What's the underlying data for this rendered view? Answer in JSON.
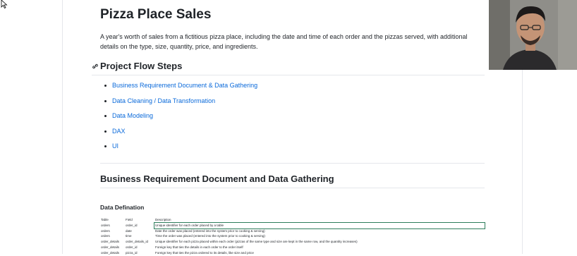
{
  "title": "Pizza Place Sales",
  "description": "A year's worth of sales from a fictitious pizza place, including the date and time of each order and the pizzas served, with additional details on the type, size, quantity, price, and ingredients.",
  "flow_heading": "Project Flow Steps",
  "flow_steps": [
    "Business Requirement Document & Data Gathering",
    "Data Cleaning / Data Transformation",
    "Data Modeling",
    "DAX",
    "UI"
  ],
  "section_heading": "Business Requirement Document and Data Gathering",
  "data_definition_heading": "Data Defination",
  "table": {
    "headers": [
      "Table",
      "Field",
      "Description"
    ],
    "rows": [
      [
        "orders",
        "order_id",
        "Unique identifier for each order placed by a table"
      ],
      [
        "orders",
        "date",
        "Date the order was placed (entered into the system prior to cooking & serving)"
      ],
      [
        "orders",
        "time",
        "Time the order was placed (entered into the system prior to cooking & serving)"
      ],
      [
        "order_details",
        "order_details_id",
        "Unique identifier for each pizza placed within each order (pizzas of the same type and size are kept in the same row, and the quantity increases)"
      ],
      [
        "order_details",
        "order_id",
        "Foreign key that ties the details in each order to the order itself"
      ],
      [
        "order_details",
        "pizza_id",
        "Foreign key that ties the pizza ordered to its details, like size and price"
      ]
    ]
  },
  "colors": {
    "link": "#0969da",
    "text": "#1f2328",
    "border": "#e5e7eb"
  }
}
